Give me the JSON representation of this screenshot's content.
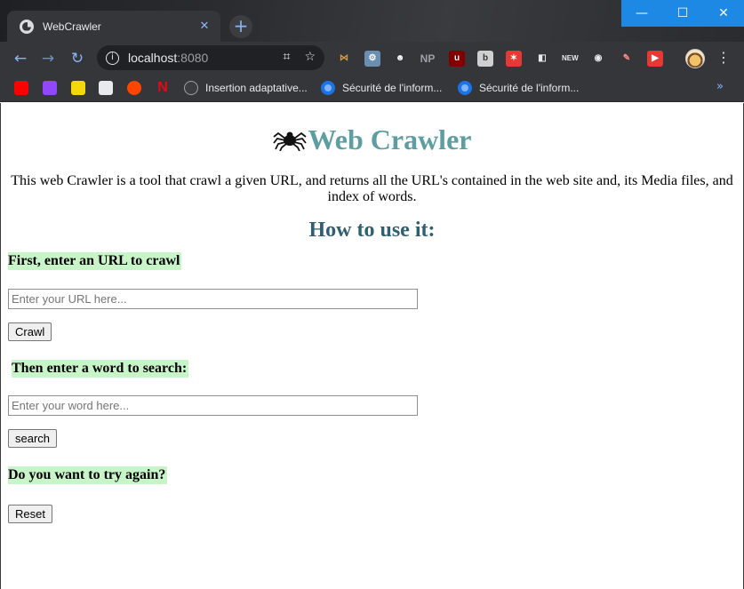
{
  "browser": {
    "tab": {
      "title": "WebCrawler",
      "close": "✕",
      "new_tab": "+"
    },
    "window": {
      "minimize": "—",
      "maximize": "☐",
      "close": "✕"
    },
    "nav": {
      "back": "←",
      "forward": "→",
      "reload": "↻"
    },
    "address": {
      "info": "i",
      "host": "localhost",
      "port": ":8080"
    },
    "omnibox_icons": [
      "translate-icon",
      "star-icon"
    ],
    "extensions": [
      "ext-1",
      "ext-2",
      "ext-3",
      "NP",
      "ext-ublock",
      "ext-b6",
      "ext-6",
      "ext-7",
      "ext-new",
      "ext-9",
      "ext-eraser",
      "ext-11"
    ],
    "menu": "⋮",
    "bookmarks": [
      {
        "icon": "youtube-icon"
      },
      {
        "icon": "twitch-icon"
      },
      {
        "icon": "t-icon"
      },
      {
        "icon": "bookmark-icon"
      },
      {
        "icon": "reddit-icon"
      },
      {
        "icon": "netflix-icon"
      },
      {
        "label": "Insertion adaptative...",
        "icon": "hal-icon"
      },
      {
        "label": "Sécurité de l'inform...",
        "icon": "globe-icon"
      },
      {
        "label": "Sécurité de l'inform...",
        "icon": "globe-icon"
      }
    ],
    "bookmarks_more": "»"
  },
  "page": {
    "title": "Web Crawler",
    "intro": "This web Crawler is a tool that crawl a given URL, and returns all the URL's contained in the web site and, its Media files, and index of words.",
    "howto": "How to use it:",
    "step1": "First, enter an URL to crawl",
    "url_placeholder": "Enter your URL here...",
    "crawl_button": "Crawl",
    "step2": "Then enter a word to search:",
    "word_placeholder": "Enter your word here...",
    "search_button": "search",
    "step3": "Do you want to try again?",
    "reset_button": "Reset",
    "colors": {
      "title": "#5f9ea0",
      "howto": "#2e5f72",
      "highlight": "#c8f5c8"
    }
  }
}
